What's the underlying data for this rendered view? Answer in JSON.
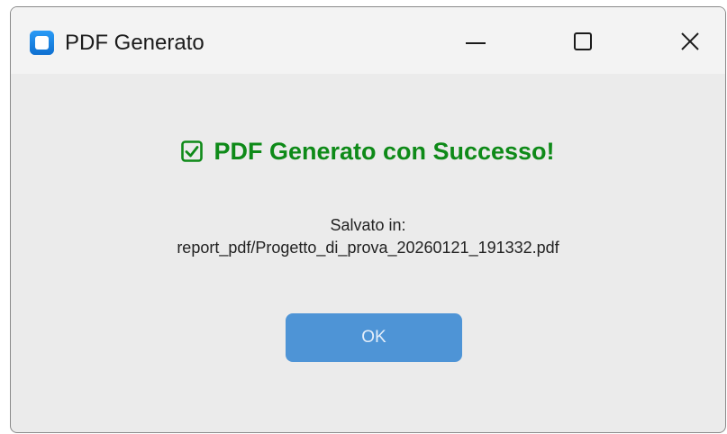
{
  "window": {
    "title": "PDF Generato",
    "icon": "app-icon",
    "controls": {
      "minimize": "minimize-icon",
      "maximize": "maximize-icon",
      "close": "close-icon"
    }
  },
  "dialog": {
    "headline": "PDF Generato con Successo!",
    "headline_icon": "check-box-icon",
    "saved_label": "Salvato in:",
    "saved_path": "report_pdf/Progetto_di_prova_20260121_191332.pdf",
    "ok_label": "OK"
  },
  "colors": {
    "success_green": "#0e8a18",
    "button_blue": "#4e94d6",
    "dialog_background": "#ebebeb"
  }
}
